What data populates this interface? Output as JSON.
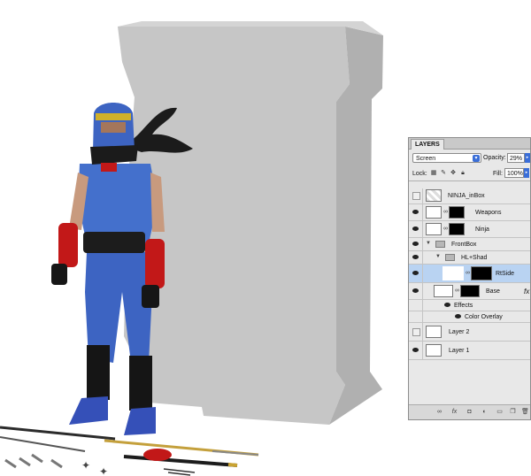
{
  "panel": {
    "tab_label": "LAYERS",
    "blend_mode": "Screen",
    "opacity_label": "Opacity:",
    "opacity_value": "29%",
    "lock_label": "Lock:",
    "fill_label": "Fill:",
    "fill_value": "100%",
    "selection_color": "#b9d3f2"
  },
  "layers": [
    {
      "name": "NINJA_inBox",
      "visible": false,
      "type": "layer"
    },
    {
      "name": "Weapons",
      "visible": true,
      "type": "layer-with-mask"
    },
    {
      "name": "Ninja",
      "visible": true,
      "type": "layer-with-mask"
    },
    {
      "name": "FrontBox",
      "visible": true,
      "type": "group"
    },
    {
      "name": "HL+Shad",
      "visible": true,
      "type": "group"
    },
    {
      "name": "RtSide",
      "visible": true,
      "type": "layer-with-mask",
      "selected": true
    },
    {
      "name": "Base",
      "visible": true,
      "type": "layer-with-mask",
      "fx": "fx"
    },
    {
      "name": "Effects",
      "visible": true,
      "type": "effects"
    },
    {
      "name": "Color Overlay",
      "visible": true,
      "type": "effect"
    },
    {
      "name": "Layer 2",
      "visible": false,
      "type": "layer"
    },
    {
      "name": "Layer 1",
      "visible": true,
      "type": "layer"
    }
  ],
  "bottom_icons": [
    "link-icon",
    "fx-icon",
    "mask-icon",
    "adjustment-icon",
    "new-group-icon",
    "new-layer-icon",
    "trash-icon"
  ],
  "canvas": {
    "box_color": "#c6c6c6",
    "box_side_color": "#b0b0b0",
    "ninja_blue": "#3d64c2",
    "accent_red": "#c21818"
  }
}
